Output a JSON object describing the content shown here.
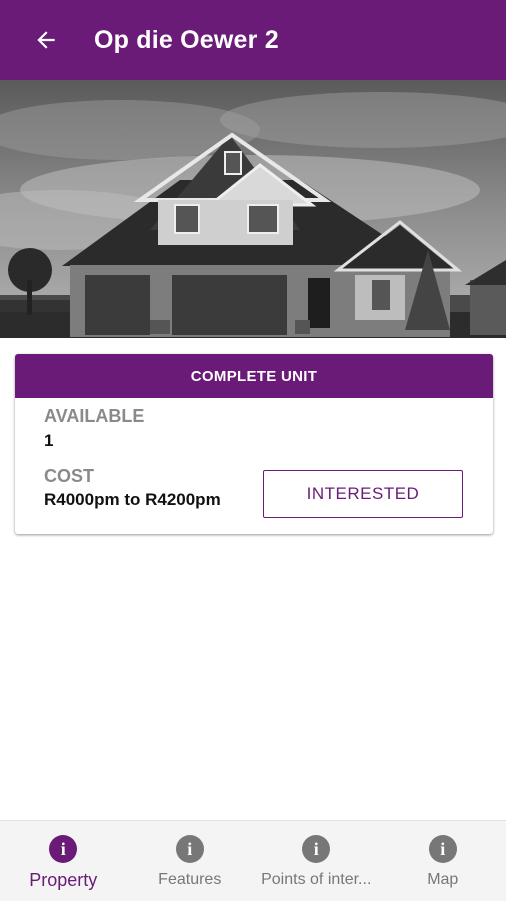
{
  "header": {
    "title": "Op die Oewer 2",
    "back_icon": "arrow-back-icon",
    "color": "#6a1b78"
  },
  "hero": {
    "image": "house-photo"
  },
  "unit_card": {
    "title": "COMPLETE UNIT",
    "available_label": "AVAILABLE",
    "available_value": "1",
    "cost_label": "COST",
    "cost_value": "R4000pm to R4200pm",
    "interested_label": "INTERESTED"
  },
  "bottom_nav": {
    "items": [
      {
        "label": "Property",
        "icon": "info-icon",
        "active": true
      },
      {
        "label": "Features",
        "icon": "info-icon",
        "active": false
      },
      {
        "label": "Points of inter...",
        "icon": "info-icon",
        "active": false
      },
      {
        "label": "Map",
        "icon": "info-icon",
        "active": false
      }
    ]
  }
}
